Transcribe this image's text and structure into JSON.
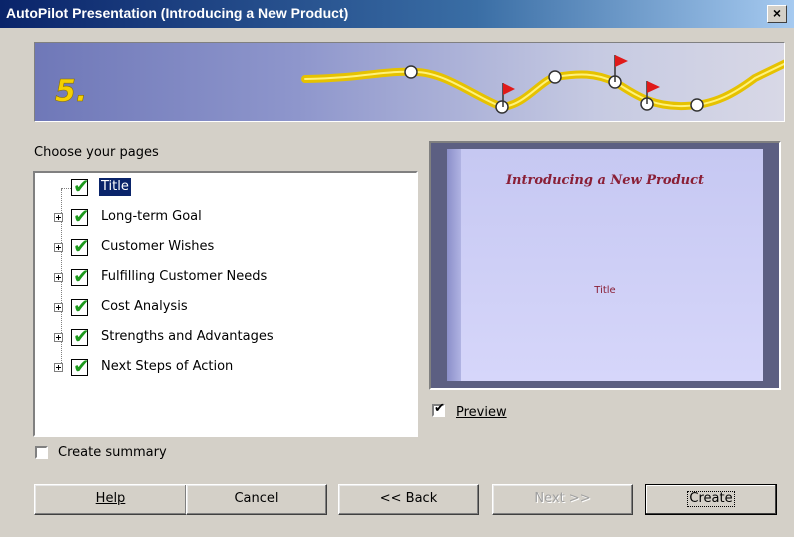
{
  "window": {
    "title": "AutoPilot Presentation (Introducing a New Product)",
    "close_label": "×"
  },
  "banner": {
    "step": "5."
  },
  "pages": {
    "label": "Choose your pages",
    "items": [
      {
        "label": "Title",
        "checked": true,
        "expandable": false,
        "selected": true
      },
      {
        "label": "Long-term Goal",
        "checked": true,
        "expandable": true
      },
      {
        "label": "Customer Wishes",
        "checked": true,
        "expandable": true
      },
      {
        "label": "Fulfilling Customer Needs",
        "checked": true,
        "expandable": true
      },
      {
        "label": "Cost Analysis",
        "checked": true,
        "expandable": true
      },
      {
        "label": "Strengths and Advantages",
        "checked": true,
        "expandable": true
      },
      {
        "label": "Next Steps of Action",
        "checked": true,
        "expandable": true
      }
    ]
  },
  "preview": {
    "slide_title": "Introducing a New Product",
    "slide_subtitle": "Title",
    "checkbox_label": "Preview",
    "checked": true
  },
  "summary": {
    "label": "Create summary",
    "checked": false
  },
  "buttons": {
    "help": "Help",
    "cancel": "Cancel",
    "back": "<< Back",
    "next": "Next >>",
    "create": "Create"
  },
  "colors": {
    "titlebar": "#0a246a",
    "selection": "#0a246a",
    "check": "#1d9a1d",
    "slide_text": "#8a1f36"
  }
}
